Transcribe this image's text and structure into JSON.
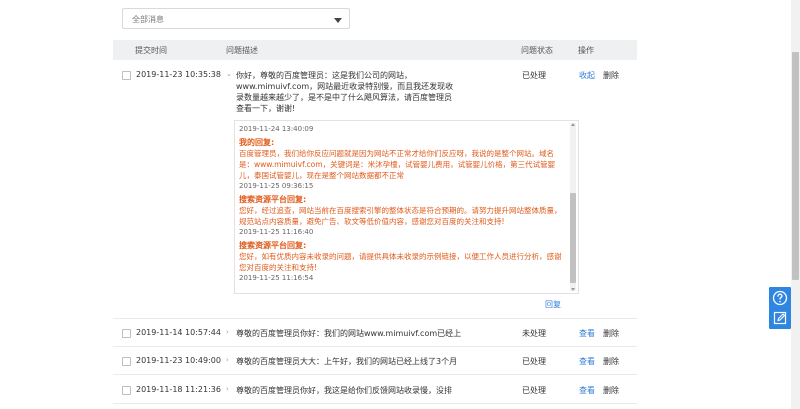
{
  "filter": {
    "selected": "全部消息"
  },
  "table": {
    "headers": {
      "time": "提交时间",
      "desc": "问题描述",
      "status": "问题状态",
      "ops": "操作"
    }
  },
  "rows": [
    {
      "date": "2019-11-23 10:35:38",
      "desc": "你好，尊敬的百度管理员：这是我们公司的网站，www.mimuivf.com，网站最近收录特别慢，而且我还发现收录数量越来越少了，是不是中了什么飓风算法，请百度管理员查看一下，谢谢!",
      "status": "已处理",
      "action": "收起",
      "delete": "删除"
    },
    {
      "date": "2019-11-14 10:57:44",
      "desc": "尊敬的百度管理员你好：我们的网站www.mimuivf.com已经上",
      "status": "未处理",
      "action": "查看",
      "delete": "删除"
    },
    {
      "date": "2019-11-23 10:49:00",
      "desc": "尊敬的百度管理员大大：上午好，我们的网站已经上线了3个月",
      "status": "已处理",
      "action": "查看",
      "delete": "删除"
    },
    {
      "date": "2019-11-18 11:21:36",
      "desc": "尊敬的百度管理员你好，我这是给你们反馈网站收录慢，没排",
      "status": "已处理",
      "action": "查看",
      "delete": "删除"
    }
  ],
  "replies": [
    {
      "time": "2019-11-24 13:40:09"
    },
    {
      "name": "我的回复:",
      "text": "百度管理员，我们给你反应问题就是因为网站不正常才给你们反应呀，我说的是整个网站。域名是：www.mimuivf.com，关键词是：米沐孕橦，试管婴儿费用，试管婴儿价格，第三代试管婴儿，泰国试管婴儿，现在是整个网站数据都不正常",
      "time": "2019-11-25 09:36:15"
    },
    {
      "name": "搜索资源平台回复:",
      "text": "您好，经过追查，网站当前在百度搜索引擎的整体状态是符合预期的。请努力提升网站整体质量，规范站点内容质量，避免广告、软文等低价值内容，感谢您对百度的关注和支持!",
      "time": "2019-11-25 11:16:40"
    },
    {
      "name": "搜索资源平台回复:",
      "text": "您好，如有优质内容未收录的问题，请提供具体未收录的示例链接，以便工作人员进行分析，感谢您对百度的关注和支持!",
      "time": "2019-11-25 11:16:54"
    }
  ],
  "reply_button": "回复",
  "icons": {
    "help": "question-circle-icon",
    "feedback": "edit-icon",
    "accent": "#2f86e0",
    "reply_color": "#e05a1a",
    "link_color": "#2f7bd8"
  }
}
